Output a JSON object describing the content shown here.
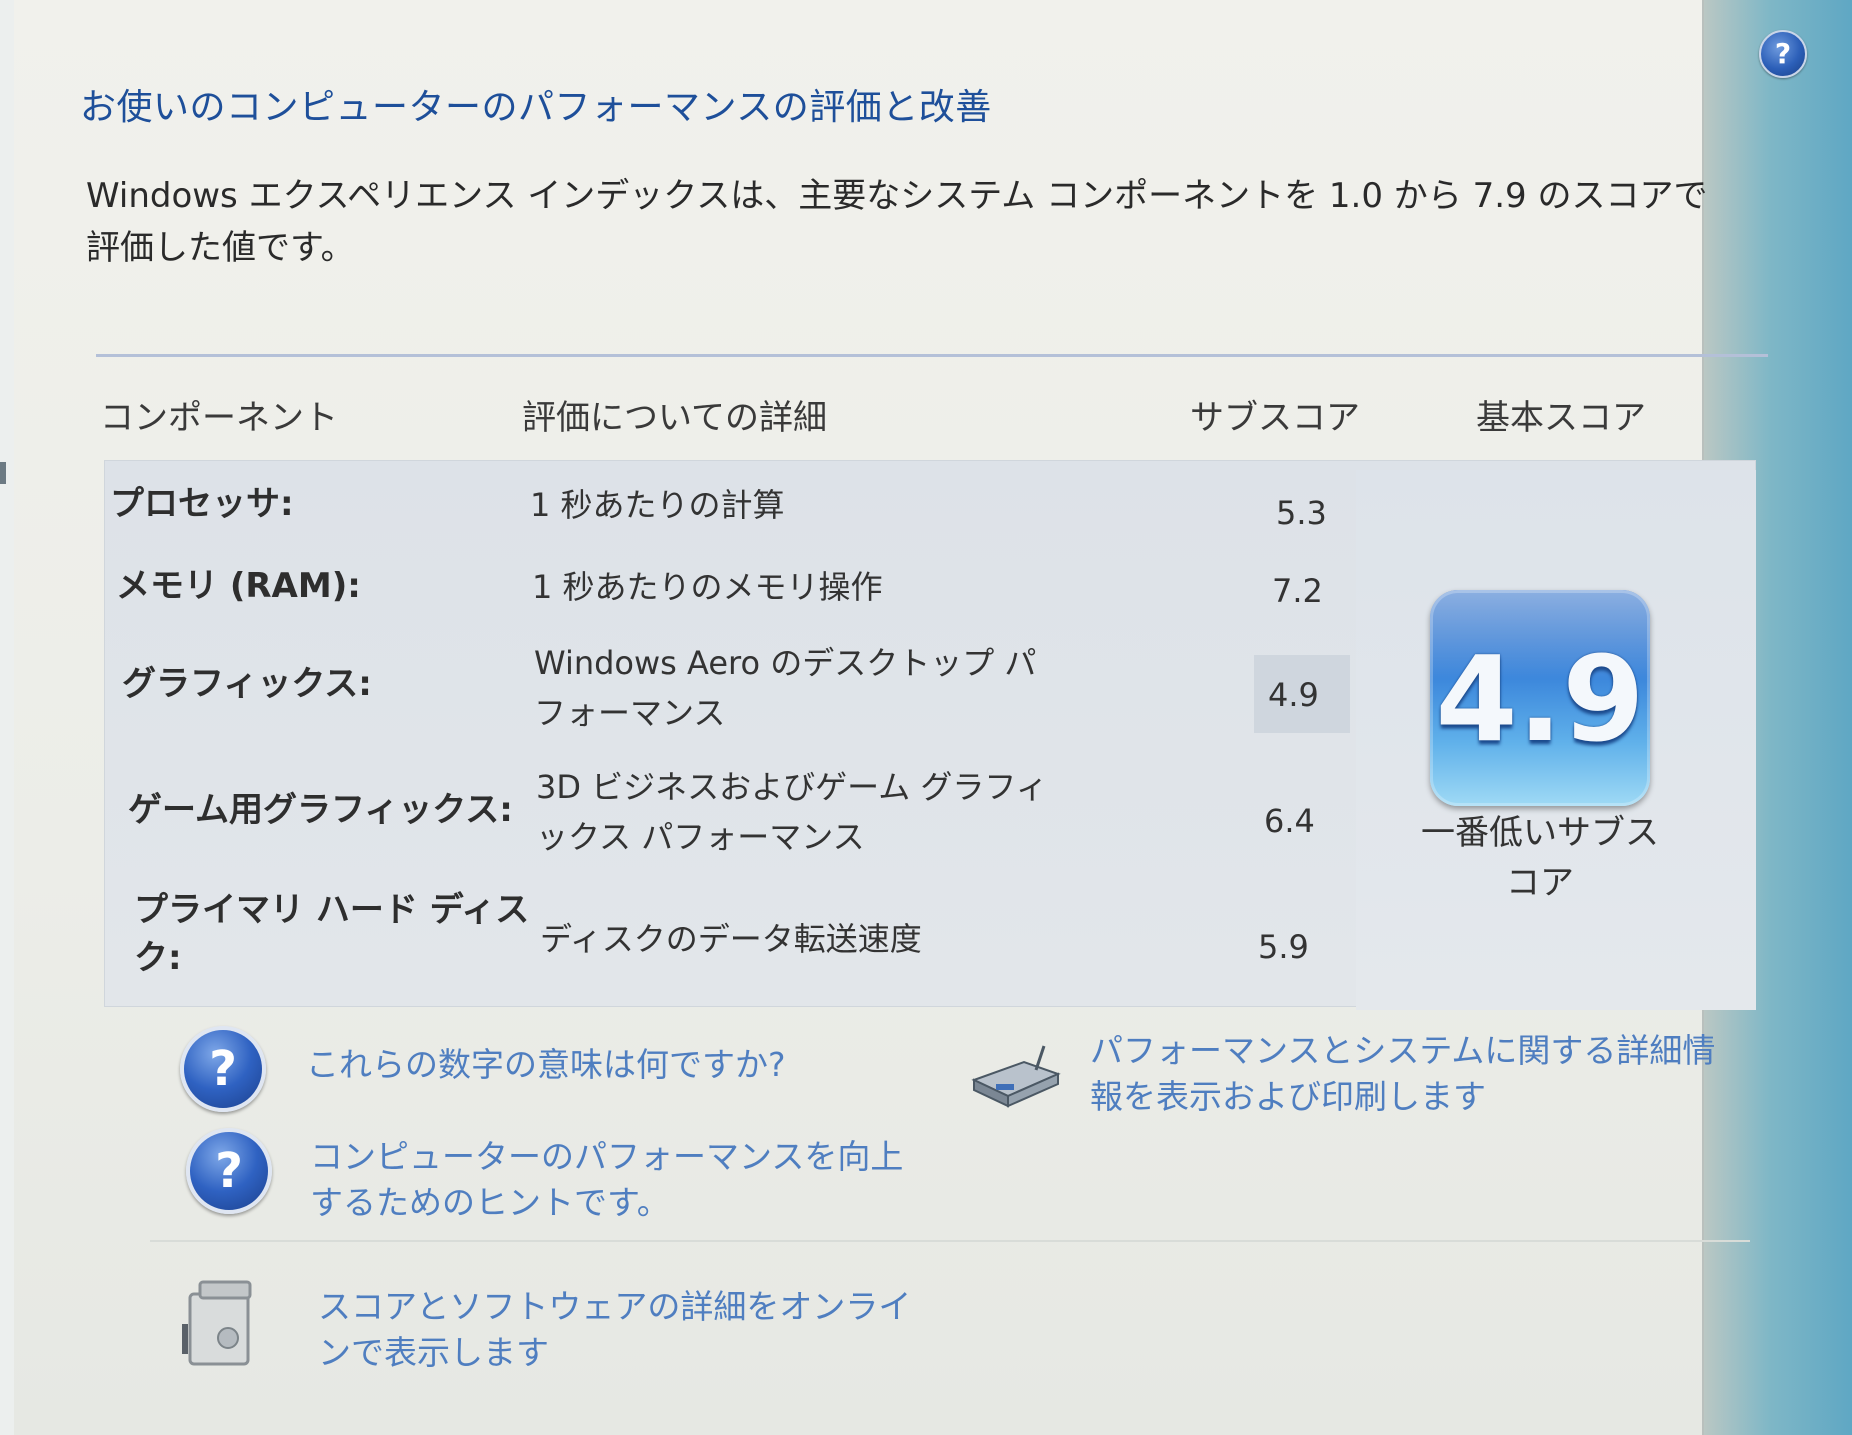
{
  "window": {
    "help_icon": "help-icon",
    "title": "お使いのコンピューターのパフォーマンスの評価と改善",
    "intro_line1": "Windows エクスペリエンス インデックスは、主要なシステム コンポーネントを 1.0 から 7.9 のスコアで",
    "intro_line2": "評価した値です。"
  },
  "table": {
    "headers": {
      "component": "コンポーネント",
      "details": "評価についての詳細",
      "subscore": "サブスコア",
      "base_score": "基本スコア"
    },
    "rows": [
      {
        "label": "プロセッサ:",
        "desc1": "1 秒あたりの計算",
        "desc2": "",
        "score": "5.3"
      },
      {
        "label": "メモリ (RAM):",
        "desc1": "1 秒あたりのメモリ操作",
        "desc2": "",
        "score": "7.2"
      },
      {
        "label": "グラフィックス:",
        "desc1": "Windows Aero のデスクトップ パ",
        "desc2": "フォーマンス",
        "score": "4.9"
      },
      {
        "label": "ゲーム用グラフィックス:",
        "desc1": "3D ビジネスおよびゲーム グラフィ",
        "desc2": "ックス パフォーマンス",
        "score": "6.4"
      },
      {
        "label1": "プライマリ ハード ディス",
        "label2": "ク:",
        "desc1": "ディスクのデータ転送速度",
        "desc2": "",
        "score": "5.9"
      }
    ],
    "base_score": {
      "value": "4.9",
      "caption1": "一番低いサブス",
      "caption2": "コア"
    }
  },
  "links": {
    "meaning": "これらの数字の意味は何ですか?",
    "tips1": "コンピューターのパフォーマンスを向上",
    "tips2": "するためのヒントです。",
    "print1": "パフォーマンスとシステムに関する詳細情",
    "print2": "報を表示および印刷します",
    "online1": "スコアとソフトウェアの詳細をオンライ",
    "online2": "ンで表示します"
  },
  "icons": {
    "help": "question-icon",
    "printer": "printer-icon",
    "online": "online-details-icon"
  },
  "colors": {
    "title": "#1e4f9a",
    "link": "#4f7ec0",
    "tile_top": "#2f6fc9",
    "tile_bottom": "#9fdaf5"
  }
}
